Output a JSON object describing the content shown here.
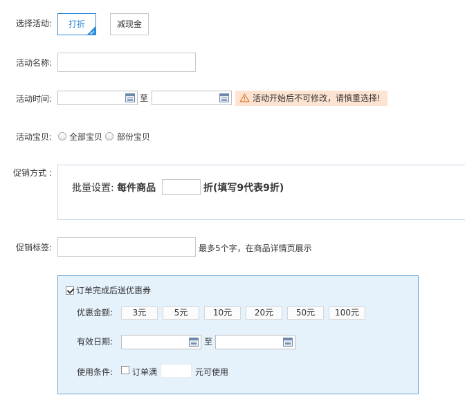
{
  "activity_select": {
    "label": "选择活动:",
    "options": [
      {
        "label": "打折",
        "active": true
      },
      {
        "label": "减现金",
        "active": false
      }
    ]
  },
  "activity_name": {
    "label": "活动名称:",
    "value": "",
    "placeholder": ""
  },
  "activity_time": {
    "label": "活动时间:",
    "start_value": "",
    "end_value": "",
    "separator": "至",
    "warning_icon": "warning-triangle-icon",
    "warning_text": "活动开始后不可修改，请慎重选择!",
    "warning_bg": "#fde3d1"
  },
  "activity_items": {
    "label": "活动宝贝:",
    "options": [
      {
        "label": "全部宝贝",
        "selected": false
      },
      {
        "label": "部份宝贝",
        "selected": false
      }
    ]
  },
  "promo_method": {
    "label": "促销方式 :",
    "batch_label": "批量设置:",
    "per_item": "每件商品",
    "discount_value": "",
    "suffix": "折(填写9代表9折)"
  },
  "promo_tag": {
    "label": "促销标签:",
    "value": "",
    "hint": "最多5个字，在商品详情页展示"
  },
  "coupon": {
    "enabled": true,
    "title": "订单完成后送优惠券",
    "amount_label": "优惠金额:",
    "amounts": [
      "3元",
      "5元",
      "10元",
      "20元",
      "50元",
      "100元"
    ],
    "valid_label": "有效日期:",
    "valid_start": "",
    "valid_end": "",
    "separator": "至",
    "condition_label": "使用条件:",
    "condition_enabled": false,
    "condition_prefix": "订单满",
    "condition_value": "",
    "condition_suffix": "元可使用",
    "panel_bg": "#e5f1fb",
    "panel_border": "#6aa7d8"
  },
  "colors": {
    "accent": "#2d8bd8"
  }
}
